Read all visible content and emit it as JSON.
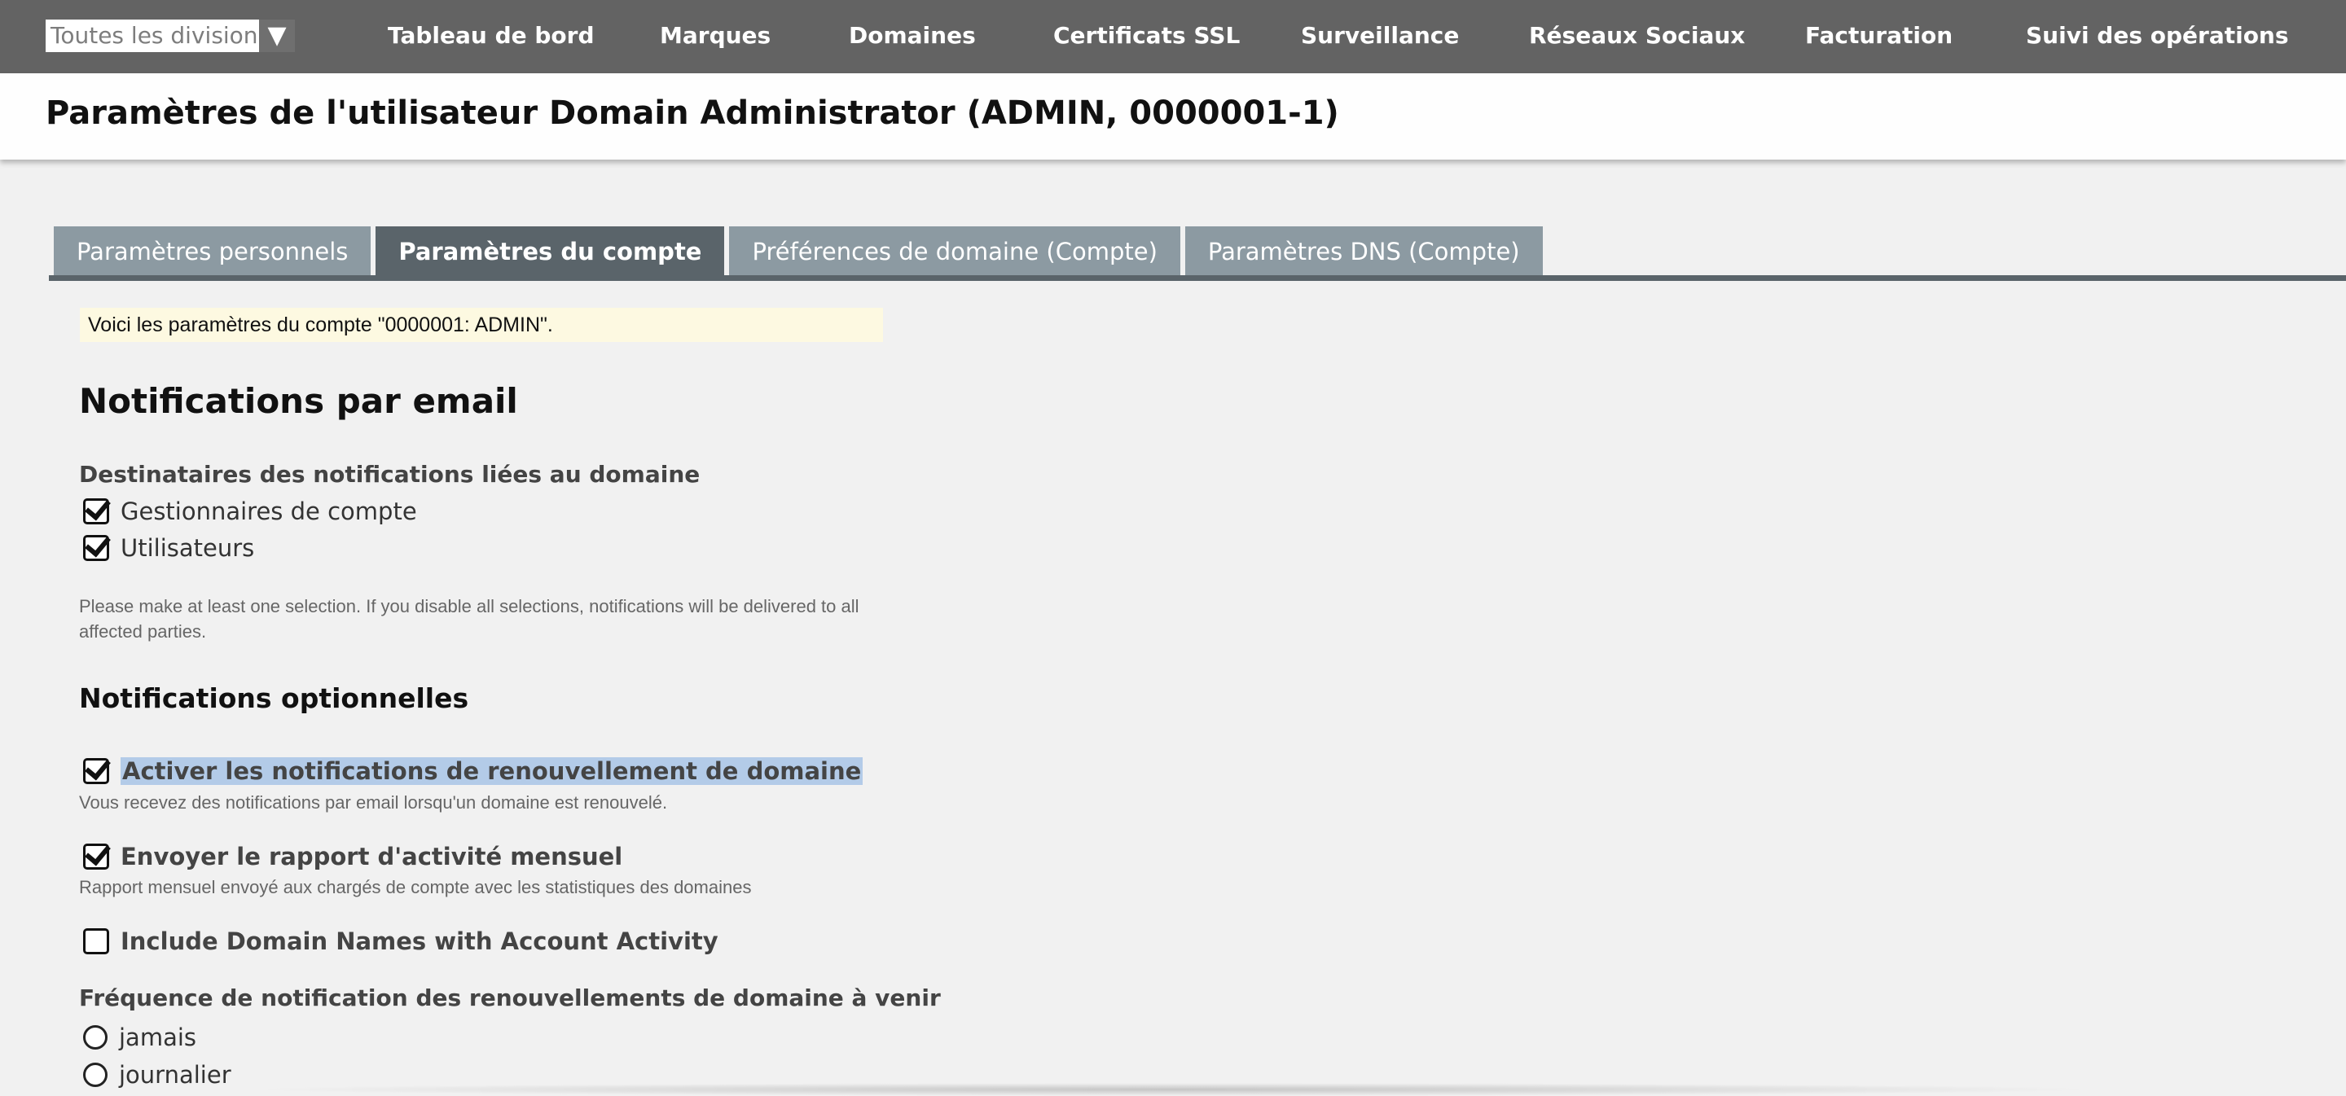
{
  "nav": {
    "division_select": "Toutes les divisions",
    "division_arrow": "▼",
    "items": [
      "Tableau de bord",
      "Marques",
      "Domaines",
      "Certificats SSL",
      "Surveillance",
      "Réseaux Sociaux",
      "Facturation",
      "Suivi des opérations"
    ]
  },
  "header": {
    "title": "Paramètres de l'utilisateur Domain Administrator (ADMIN, 0000001-1)"
  },
  "tabs": [
    {
      "label": "Paramètres personnels",
      "active": false
    },
    {
      "label": "Paramètres du compte",
      "active": true
    },
    {
      "label": "Préférences de domaine (Compte)",
      "active": false
    },
    {
      "label": "Paramètres DNS (Compte)",
      "active": false
    }
  ],
  "content": {
    "info": "Voici les paramètres du compte \"0000001: ADMIN\".",
    "email_heading": "Notifications par email",
    "recipients_label": "Destinataires des notifications liées au domaine",
    "recipients": [
      {
        "label": "Gestionnaires de compte",
        "checked": true
      },
      {
        "label": "Utilisateurs",
        "checked": true
      }
    ],
    "recipients_note": "Please make at least one selection. If you disable all selections, notifications will be delivered to all affected parties.",
    "optional_heading": "Notifications optionnelles",
    "optional": [
      {
        "label": "Activer les notifications de renouvellement de domaine",
        "checked": true,
        "description": "Vous recevez des notifications par email lorsqu'un domaine est renouvelé."
      },
      {
        "label": "Envoyer le rapport d'activité mensuel",
        "checked": true,
        "description": "Rapport mensuel envoyé aux chargés de compte avec les statistiques des domaines"
      },
      {
        "label": "Include Domain Names with Account Activity",
        "checked": false,
        "description": ""
      }
    ],
    "frequency_label": "Fréquence de notification des renouvellements de domaine à venir",
    "frequency_options": [
      "jamais",
      "journalier"
    ]
  }
}
